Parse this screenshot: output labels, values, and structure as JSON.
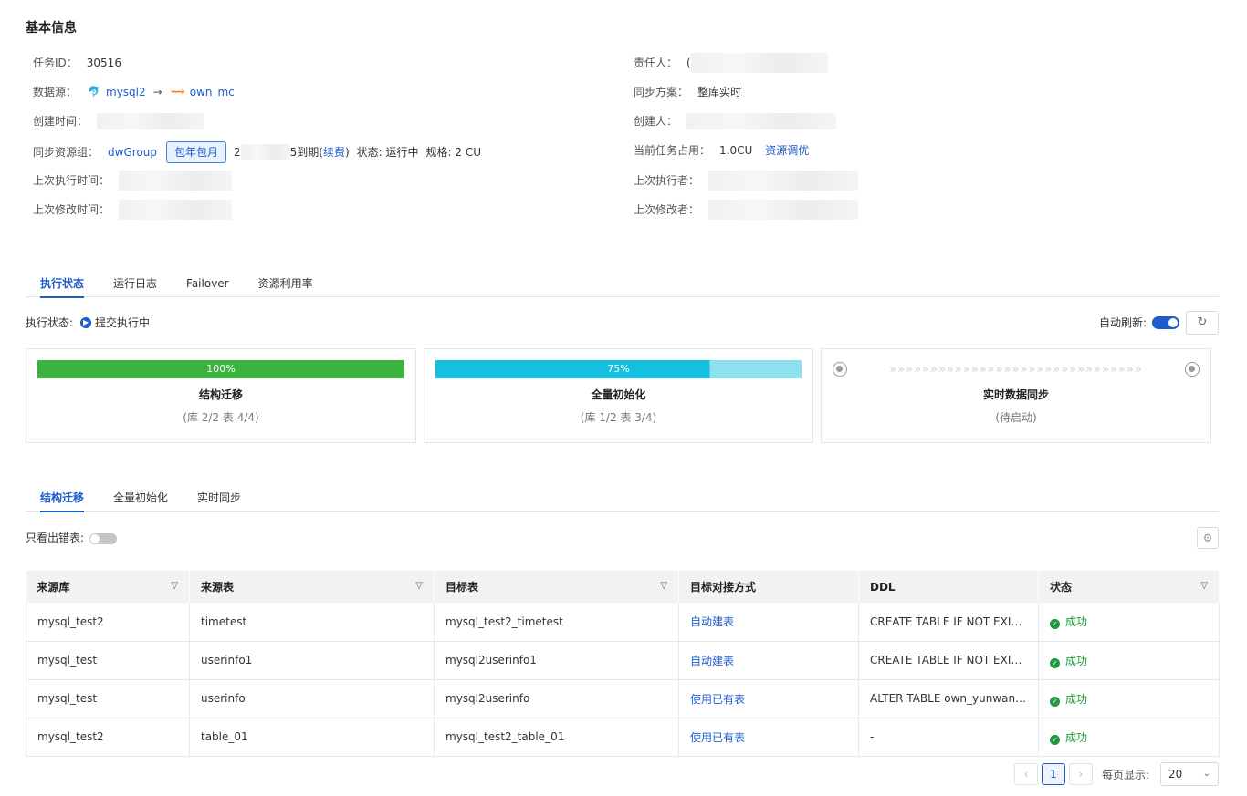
{
  "basic": {
    "title": "基本信息",
    "task_id_label": "任务ID：",
    "task_id": "30516",
    "datasource_label": "数据源：",
    "source_name": "mysql2",
    "arrow": "→",
    "target_name": "own_mc",
    "created_time_label": "创建时间：",
    "resource_group_label": "同步资源组：",
    "resource_group": "dwGroup",
    "billing_tag": "包年包月",
    "expiry_prefix": "2",
    "expiry_suffix": "5到期(",
    "renew_link": "续费",
    "expiry_close": ")",
    "state_text": "状态: 运行中",
    "spec_text": "规格: 2 CU",
    "last_exec_time_label": "上次执行时间：",
    "last_modified_time_label": "上次修改时间：",
    "owner_label": "责任人：",
    "owner_prefix": "(",
    "sync_plan_label": "同步方案：",
    "sync_plan": "整库实时",
    "creator_label": "创建人：",
    "current_usage_label": "当前任务占用：",
    "current_usage": "1.0CU",
    "resource_adjust_link": "资源调优",
    "last_executor_label": "上次执行者：",
    "last_modifier_label": "上次修改者："
  },
  "tabs1": [
    "执行状态",
    "运行日志",
    "Failover",
    "资源利用率"
  ],
  "exec": {
    "label": "执行状态:",
    "state": "提交执行中",
    "auto_refresh_label": "自动刷新:",
    "refresh_icon": "↻"
  },
  "stages": [
    {
      "progress_text": "100%",
      "progress": 1.0,
      "title": "结构迁移",
      "sub": "(库 2/2 表 4/4)",
      "color": "#3bb33e"
    },
    {
      "progress_text": "75%",
      "progress": 0.75,
      "title": "全量初始化",
      "sub": "(库 1/2 表 3/4)",
      "color": "#14bfe0",
      "track": "#8fe0ef"
    },
    {
      "title": "实时数据同步",
      "sub": "(待启动)",
      "chevrons": "»»»»»»»»»»»»»»»»»»»»»»»»»»»»»»»"
    }
  ],
  "tabs2": [
    "结构迁移",
    "全量初始化",
    "实时同步"
  ],
  "filter": {
    "only_error_label": "只看出错表:"
  },
  "table": {
    "headers": [
      "来源库",
      "来源表",
      "目标表",
      "目标对接方式",
      "DDL",
      "状态"
    ],
    "rows": [
      {
        "db": "mysql_test2",
        "src": "timetest",
        "dst": "mysql_test2_timetest",
        "mode": "自动建表",
        "ddl": "CREATE TABLE IF NOT EXISTS...",
        "status": "成功"
      },
      {
        "db": "mysql_test",
        "src": "userinfo1",
        "dst": "mysql2userinfo1",
        "mode": "自动建表",
        "ddl": "CREATE TABLE IF NOT EXISTS...",
        "status": "成功"
      },
      {
        "db": "mysql_test",
        "src": "userinfo",
        "dst": "mysql2userinfo",
        "mode": "使用已有表",
        "ddl": "ALTER TABLE own_yunwan1....",
        "status": "成功"
      },
      {
        "db": "mysql_test2",
        "src": "table_01",
        "dst": "mysql_test2_table_01",
        "mode": "使用已有表",
        "ddl": "-",
        "status": "成功"
      }
    ]
  },
  "pager": {
    "prev": "‹",
    "current": "1",
    "next": "›",
    "size_label": "每页显示:",
    "size": "20"
  }
}
